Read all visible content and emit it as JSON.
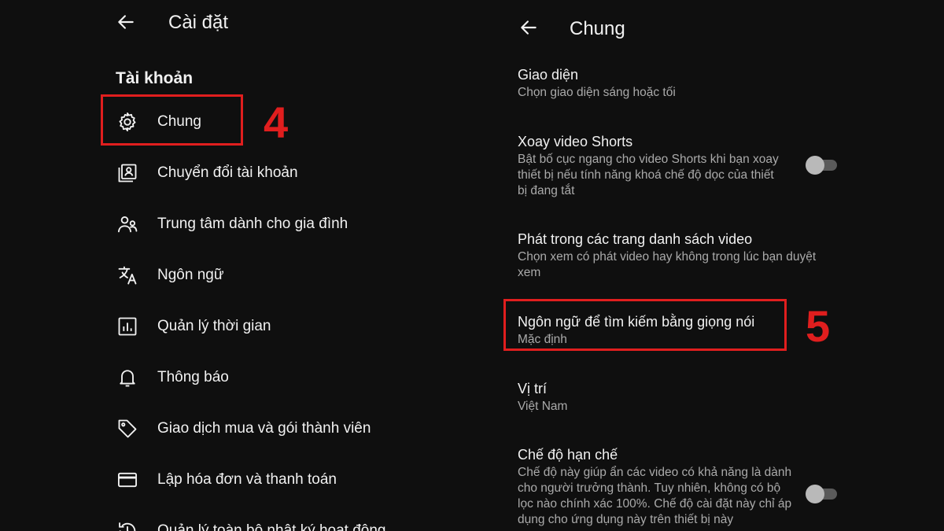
{
  "left": {
    "header_title": "Cài đặt",
    "section_heading": "Tài khoản",
    "items": [
      {
        "label": "Chung",
        "icon": "gear-icon"
      },
      {
        "label": "Chuyển đổi tài khoản",
        "icon": "switch-account-icon"
      },
      {
        "label": "Trung tâm dành cho gia đình",
        "icon": "family-icon"
      },
      {
        "label": "Ngôn ngữ",
        "icon": "translate-icon"
      },
      {
        "label": "Quản lý thời gian",
        "icon": "bar-chart-icon"
      },
      {
        "label": "Thông báo",
        "icon": "bell-icon"
      },
      {
        "label": "Giao dịch mua và gói thành viên",
        "icon": "tag-icon"
      },
      {
        "label": "Lập hóa đơn và thanh toán",
        "icon": "credit-card-icon"
      },
      {
        "label": "Quản lý toàn bộ nhật ký hoạt động",
        "icon": "history-icon"
      }
    ],
    "step": "4"
  },
  "right": {
    "header_title": "Chung",
    "settings": [
      {
        "title": "Giao diện",
        "desc": "Chọn giao diện sáng hoặc tối"
      },
      {
        "title": "Xoay video Shorts",
        "desc": "Bật bố cục ngang cho video Shorts khi bạn xoay thiết bị nếu tính năng khoá chế độ dọc của thiết bị đang tắt",
        "toggle": "off"
      },
      {
        "title": "Phát trong các trang danh sách video",
        "desc": "Chọn xem có phát video hay không trong lúc bạn duyệt xem"
      },
      {
        "title": "Ngôn ngữ để tìm kiếm bằng giọng nói",
        "desc": "Mặc định"
      },
      {
        "title": "Vị trí",
        "desc": "Việt Nam"
      },
      {
        "title": "Chế độ hạn chế",
        "desc": "Chế độ này giúp ẩn các video có khả năng là dành cho người trưởng thành. Tuy nhiên, không có bộ lọc nào chính xác 100%. Chế độ cài đặt này chỉ áp dụng cho ứng dụng này trên thiết bị này",
        "toggle": "off"
      }
    ],
    "step": "5"
  },
  "colors": {
    "background": "#0f0f0f",
    "text": "#f1f1f1",
    "secondary_text": "#aaaaaa",
    "highlight": "#e01e1e"
  }
}
